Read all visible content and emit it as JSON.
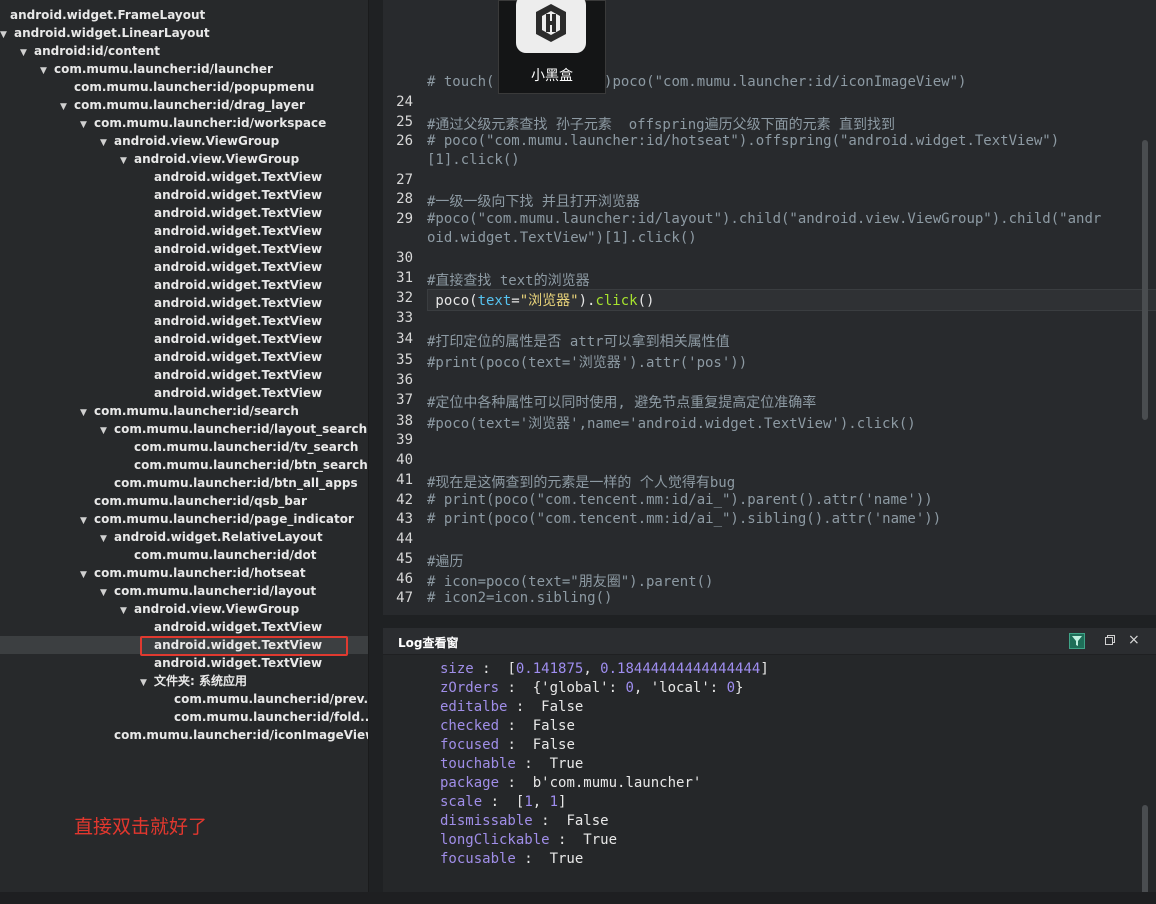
{
  "tree": {
    "rows": [
      {
        "label": "android.widget.FrameLayout",
        "arrow": "",
        "indent": -4
      },
      {
        "label": "android.widget.LinearLayout",
        "arrow": "▼",
        "indent": 0
      },
      {
        "label": "android:id/content",
        "arrow": "▼",
        "indent": 20
      },
      {
        "label": "com.mumu.launcher:id/launcher",
        "arrow": "▼",
        "indent": 40
      },
      {
        "label": "com.mumu.launcher:id/popupmenu",
        "arrow": "",
        "indent": 60
      },
      {
        "label": "com.mumu.launcher:id/drag_layer",
        "arrow": "▼",
        "indent": 60
      },
      {
        "label": "com.mumu.launcher:id/workspace",
        "arrow": "▼",
        "indent": 80
      },
      {
        "label": "android.view.ViewGroup",
        "arrow": "▼",
        "indent": 100
      },
      {
        "label": "android.view.ViewGroup",
        "arrow": "▼",
        "indent": 120
      },
      {
        "label": "android.widget.TextView",
        "arrow": "",
        "indent": 140
      },
      {
        "label": "android.widget.TextView",
        "arrow": "",
        "indent": 140
      },
      {
        "label": "android.widget.TextView",
        "arrow": "",
        "indent": 140
      },
      {
        "label": "android.widget.TextView",
        "arrow": "",
        "indent": 140
      },
      {
        "label": "android.widget.TextView",
        "arrow": "",
        "indent": 140
      },
      {
        "label": "android.widget.TextView",
        "arrow": "",
        "indent": 140
      },
      {
        "label": "android.widget.TextView",
        "arrow": "",
        "indent": 140
      },
      {
        "label": "android.widget.TextView",
        "arrow": "",
        "indent": 140
      },
      {
        "label": "android.widget.TextView",
        "arrow": "",
        "indent": 140
      },
      {
        "label": "android.widget.TextView",
        "arrow": "",
        "indent": 140
      },
      {
        "label": "android.widget.TextView",
        "arrow": "",
        "indent": 140
      },
      {
        "label": "android.widget.TextView",
        "arrow": "",
        "indent": 140
      },
      {
        "label": "android.widget.TextView",
        "arrow": "",
        "indent": 140
      },
      {
        "label": "com.mumu.launcher:id/search",
        "arrow": "▼",
        "indent": 80
      },
      {
        "label": "com.mumu.launcher:id/layout_search",
        "arrow": "▼",
        "indent": 100
      },
      {
        "label": "com.mumu.launcher:id/tv_search",
        "arrow": "",
        "indent": 120
      },
      {
        "label": "com.mumu.launcher:id/btn_search",
        "arrow": "",
        "indent": 120
      },
      {
        "label": "com.mumu.launcher:id/btn_all_apps",
        "arrow": "",
        "indent": 100
      },
      {
        "label": "com.mumu.launcher:id/qsb_bar",
        "arrow": "",
        "indent": 80
      },
      {
        "label": "com.mumu.launcher:id/page_indicator",
        "arrow": "▼",
        "indent": 80
      },
      {
        "label": "android.widget.RelativeLayout",
        "arrow": "▼",
        "indent": 100
      },
      {
        "label": "com.mumu.launcher:id/dot",
        "arrow": "",
        "indent": 120
      },
      {
        "label": "com.mumu.launcher:id/hotseat",
        "arrow": "▼",
        "indent": 80
      },
      {
        "label": "com.mumu.launcher:id/layout",
        "arrow": "▼",
        "indent": 100
      },
      {
        "label": "android.view.ViewGroup",
        "arrow": "▼",
        "indent": 120
      },
      {
        "label": "android.widget.TextView",
        "arrow": "",
        "indent": 140
      },
      {
        "label": "android.widget.TextView",
        "arrow": "",
        "indent": 140,
        "selected": true
      },
      {
        "label": "android.widget.TextView",
        "arrow": "",
        "indent": 140
      },
      {
        "label": "文件夹: 系统应用",
        "arrow": "▼",
        "indent": 140
      },
      {
        "label": "com.mumu.launcher:id/prev...",
        "arrow": "",
        "indent": 160
      },
      {
        "label": "com.mumu.launcher:id/fold...",
        "arrow": "",
        "indent": 160
      },
      {
        "label": "com.mumu.launcher:id/iconImageView",
        "arrow": "",
        "indent": 100
      }
    ],
    "hint": "直接双击就好了"
  },
  "app_card": {
    "name": "小黑盒"
  },
  "editor": {
    "lines": [
      {
        "num": "",
        "segs": [
          {
            "t": "# touch(",
            "c": "cmt"
          },
          {
            "t": "             ",
            "c": "cmt"
          },
          {
            "t": ")poco(\"com.mumu.launcher:id/iconImageView\")",
            "c": "cmt"
          }
        ]
      },
      {
        "num": "24",
        "segs": []
      },
      {
        "num": "25",
        "segs": [
          {
            "t": "#通过父级元素查找 孙子元素  offspring遍历父级下面的元素 直到找到",
            "c": "cmt"
          }
        ]
      },
      {
        "num": "26",
        "segs": [
          {
            "t": "# poco(\"com.mumu.launcher:id/hotseat\").offspring(\"android.widget.TextView\")",
            "c": "cmt"
          }
        ]
      },
      {
        "num": "",
        "segs": [
          {
            "t": "[1].click()",
            "c": "cmt"
          }
        ]
      },
      {
        "num": "27",
        "segs": []
      },
      {
        "num": "28",
        "segs": [
          {
            "t": "#一级一级向下找 并且打开浏览器",
            "c": "cmt"
          }
        ]
      },
      {
        "num": "29",
        "segs": [
          {
            "t": "#poco(\"com.mumu.launcher:id/layout\").child(\"android.view.ViewGroup\").child(\"andr",
            "c": "cmt"
          }
        ]
      },
      {
        "num": "",
        "segs": [
          {
            "t": "oid.widget.TextView\")[1].click()",
            "c": "cmt"
          }
        ]
      },
      {
        "num": "30",
        "segs": []
      },
      {
        "num": "31",
        "segs": [
          {
            "t": "#直接查找 text的浏览器",
            "c": "cmt"
          }
        ]
      },
      {
        "num": "32",
        "segs": [
          {
            "t": " poco(",
            "c": "fn"
          },
          {
            "t": "text",
            "c": "arg"
          },
          {
            "t": "=",
            "c": "op"
          },
          {
            "t": "\"浏览器\"",
            "c": "str"
          },
          {
            "t": ").",
            "c": "op"
          },
          {
            "t": "click",
            "c": "call"
          },
          {
            "t": "()",
            "c": "op"
          }
        ]
      },
      {
        "num": "33",
        "segs": []
      },
      {
        "num": "34",
        "segs": [
          {
            "t": "#打印定位的属性是否 attr可以拿到相关属性值",
            "c": "cmt"
          }
        ]
      },
      {
        "num": "35",
        "segs": [
          {
            "t": "#print(poco(text='浏览器').attr('pos'))",
            "c": "cmt"
          }
        ]
      },
      {
        "num": "36",
        "segs": []
      },
      {
        "num": "37",
        "segs": [
          {
            "t": "#定位中各种属性可以同时使用, 避免节点重复提高定位准确率",
            "c": "cmt"
          }
        ]
      },
      {
        "num": "38",
        "segs": [
          {
            "t": "#poco(text='浏览器',name='android.widget.TextView').click()",
            "c": "cmt"
          }
        ]
      },
      {
        "num": "39",
        "segs": []
      },
      {
        "num": "40",
        "segs": []
      },
      {
        "num": "41",
        "segs": [
          {
            "t": "#现在是这俩查到的元素是一样的 个人觉得有bug",
            "c": "cmt"
          }
        ]
      },
      {
        "num": "42",
        "segs": [
          {
            "t": "# print(poco(\"com.tencent.mm:id/ai_\").parent().attr('name'))",
            "c": "cmt"
          }
        ]
      },
      {
        "num": "43",
        "segs": [
          {
            "t": "# print(poco(\"com.tencent.mm:id/ai_\").sibling().attr('name'))",
            "c": "cmt"
          }
        ]
      },
      {
        "num": "44",
        "segs": []
      },
      {
        "num": "45",
        "segs": [
          {
            "t": "#遍历",
            "c": "cmt"
          }
        ]
      },
      {
        "num": "46",
        "segs": [
          {
            "t": "# icon=poco(text=\"朋友圈\").parent()",
            "c": "cmt"
          }
        ]
      },
      {
        "num": "47",
        "segs": [
          {
            "t": "# icon2=icon.sibling()",
            "c": "cmt"
          }
        ]
      }
    ]
  },
  "log": {
    "title": "Log查看窗",
    "close": "×",
    "lines": [
      {
        "key": "size",
        "sep": " :  ",
        "segs": [
          {
            "t": "[",
            "c": "w"
          },
          {
            "t": "0.141875",
            "c": "n"
          },
          {
            "t": ", ",
            "c": "w"
          },
          {
            "t": "0.18444444444444444",
            "c": "n"
          },
          {
            "t": "]",
            "c": "w"
          }
        ]
      },
      {
        "key": "zOrders",
        "sep": " :  ",
        "segs": [
          {
            "t": "{'global': ",
            "c": "w"
          },
          {
            "t": "0",
            "c": "n"
          },
          {
            "t": ", 'local': ",
            "c": "w"
          },
          {
            "t": "0",
            "c": "n"
          },
          {
            "t": "}",
            "c": "w"
          }
        ]
      },
      {
        "key": "editalbe",
        "sep": " :  ",
        "segs": [
          {
            "t": "False",
            "c": "w"
          }
        ]
      },
      {
        "key": "checked",
        "sep": " :  ",
        "segs": [
          {
            "t": "False",
            "c": "w"
          }
        ]
      },
      {
        "key": "focused",
        "sep": " :  ",
        "segs": [
          {
            "t": "False",
            "c": "w"
          }
        ]
      },
      {
        "key": "touchable",
        "sep": " :  ",
        "segs": [
          {
            "t": "True",
            "c": "w"
          }
        ]
      },
      {
        "key": "package",
        "sep": " :  ",
        "segs": [
          {
            "t": "b'com.mumu.launcher'",
            "c": "w"
          }
        ]
      },
      {
        "key": "scale",
        "sep": " :  ",
        "segs": [
          {
            "t": "[",
            "c": "w"
          },
          {
            "t": "1",
            "c": "n"
          },
          {
            "t": ", ",
            "c": "w"
          },
          {
            "t": "1",
            "c": "n"
          },
          {
            "t": "]",
            "c": "w"
          }
        ]
      },
      {
        "key": "dismissable",
        "sep": " :  ",
        "segs": [
          {
            "t": "False",
            "c": "w"
          }
        ]
      },
      {
        "key": "longClickable",
        "sep": " :  ",
        "segs": [
          {
            "t": "True",
            "c": "w"
          }
        ]
      },
      {
        "key": "focusable",
        "sep": " :  ",
        "segs": [
          {
            "t": "True",
            "c": "w"
          }
        ]
      }
    ]
  }
}
